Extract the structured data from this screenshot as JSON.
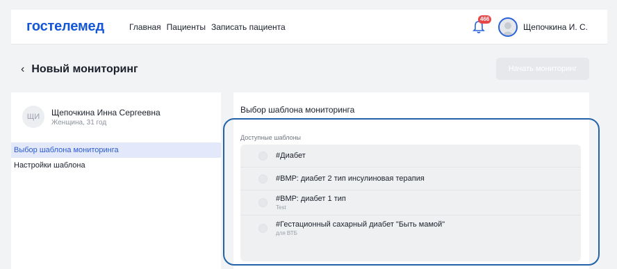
{
  "header": {
    "logo": "гостелемед",
    "nav": [
      "Главная",
      "Пациенты",
      "Записать пациента"
    ],
    "notifications_count": "466",
    "user_name": "Щепочкина И. С."
  },
  "page": {
    "back_symbol": "‹",
    "title": "Новый мониторинг",
    "start_button": "Начать мониторинг"
  },
  "patient": {
    "initials": "ЩИ",
    "name": "Щепочкина Инна Сергеевна",
    "info": "Женщина, 31 год"
  },
  "menu": [
    "Выбор шаблона мониторинга",
    "Настройки шаблона"
  ],
  "panel": {
    "title": "Выбор шаблона мониторинга",
    "available_label": "Доступные шаблоны"
  },
  "templates": [
    {
      "name": "#Диабет",
      "sub": ""
    },
    {
      "name": "#ВМР: диабет 2 тип инсулиновая терапия",
      "sub": ""
    },
    {
      "name": "#ВМР: диабет 1 тип",
      "sub": "Test"
    },
    {
      "name": "#Гестационный сахарный диабет \"Быть мамой\"",
      "sub": "для ВТБ"
    }
  ],
  "colors": {
    "brand": "#1457d6",
    "badge": "#e64646",
    "highlight": "#2361a8",
    "active_menu_bg": "#e3e9fb"
  }
}
